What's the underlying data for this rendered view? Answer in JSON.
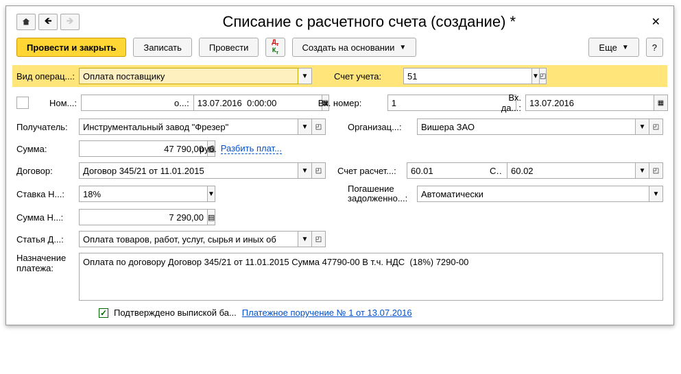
{
  "title": "Списание с расчетного счета (создание) *",
  "toolbar": {
    "post_close": "Провести и закрыть",
    "save": "Записать",
    "post": "Провести",
    "create_based": "Создать на основании",
    "more": "Еще",
    "help": "?"
  },
  "fields": {
    "op_type_label": "Вид операц...:",
    "op_type": "Оплата поставщику",
    "account_label": "Счет учета:",
    "account": "51",
    "num_label": "Ном...:",
    "num": "",
    "from_label": "о...:",
    "date": "13.07.2016  0:00:00",
    "in_num_label": "Вх. номер:",
    "in_num": "1",
    "in_date_label": "Вх. да...:",
    "in_date": "13.07.2016",
    "recipient_label": "Получатель:",
    "recipient": "Инструментальный завод \"Фрезер\"",
    "org_label": "Организац...:",
    "org": "Вишера ЗАО",
    "sum_label": "Сумма:",
    "sum": "47 790,00",
    "currency": "руб.",
    "split_link": "Разбить плат...",
    "contract_label": "Договор:",
    "contract": "Договор 345/21 от 11.01.2015",
    "acct_calc_label": "Счет расчет...:",
    "acct_calc": "60.01",
    "acct_adv_label": "Счет аван...:",
    "acct_adv": "60.02",
    "vat_rate_label": "Ставка Н...:",
    "vat_rate": "18%",
    "debt_label1": "Погашение",
    "debt_label2": "задолженно...:",
    "debt": "Автоматически",
    "vat_sum_label": "Сумма Н...:",
    "vat_sum": "7 290,00",
    "cf_item_label": "Статья Д...:",
    "cf_item": "Оплата товаров, работ, услуг, сырья и иных об",
    "purpose_label1": "Назначение",
    "purpose_label2": "платежа:",
    "purpose": "Оплата по договору Договор 345/21 от 11.01.2015 Сумма 47790-00 В т.ч. НДС  (18%) 7290-00",
    "confirmed": "Подтверждено выпиской ба...",
    "doc_link": "Платежное поручение № 1 от 13.07.2016"
  }
}
